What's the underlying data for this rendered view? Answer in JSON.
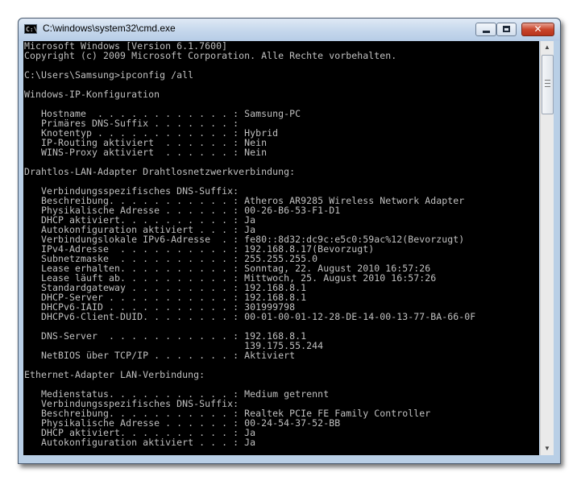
{
  "window": {
    "title": "C:\\windows\\system32\\cmd.exe",
    "icon": "cmd-icon",
    "controls": {
      "minimize": "minimize-icon",
      "maximize": "maximize-icon",
      "close_label": "✕"
    }
  },
  "colors": {
    "console_background": "#000000",
    "console_text": "#c0c0c0",
    "close_button": "#c9462c"
  },
  "console": {
    "lines": [
      "Microsoft Windows [Version 6.1.7600]",
      "Copyright (c) 2009 Microsoft Corporation. Alle Rechte vorbehalten.",
      "",
      "C:\\Users\\Samsung>ipconfig /all",
      "",
      "Windows-IP-Konfiguration",
      "",
      "   Hostname  . . . . . . . . . . . . : Samsung-PC",
      "   Primäres DNS-Suffix . . . . . . . :",
      "   Knotentyp . . . . . . . . . . . . : Hybrid",
      "   IP-Routing aktiviert  . . . . . . : Nein",
      "   WINS-Proxy aktiviert  . . . . . . : Nein",
      "",
      "Drahtlos-LAN-Adapter Drahtlosnetzwerkverbindung:",
      "",
      "   Verbindungsspezifisches DNS-Suffix:",
      "   Beschreibung. . . . . . . . . . . : Atheros AR9285 Wireless Network Adapter",
      "   Physikalische Adresse . . . . . . : 00-26-B6-53-F1-D1",
      "   DHCP aktiviert. . . . . . . . . . : Ja",
      "   Autokonfiguration aktiviert . . . : Ja",
      "   Verbindungslokale IPv6-Adresse  . : fe80::8d32:dc9c:e5c0:59ac%12(Bevorzugt)",
      "   IPv4-Adresse  . . . . . . . . . . : 192.168.8.17(Bevorzugt)",
      "   Subnetzmaske  . . . . . . . . . . : 255.255.255.0",
      "   Lease erhalten. . . . . . . . . . : Sonntag, 22. August 2010 16:57:26",
      "   Lease läuft ab. . . . . . . . . . : Mittwoch, 25. August 2010 16:57:26",
      "   Standardgateway . . . . . . . . . : 192.168.8.1",
      "   DHCP-Server . . . . . . . . . . . : 192.168.8.1",
      "   DHCPv6-IAID . . . . . . . . . . . : 301999798",
      "   DHCPv6-Client-DUID. . . . . . . . : 00-01-00-01-12-28-DE-14-00-13-77-BA-66-0F",
      "",
      "   DNS-Server  . . . . . . . . . . . : 192.168.8.1",
      "                                       139.175.55.244",
      "   NetBIOS über TCP/IP . . . . . . . : Aktiviert",
      "",
      "Ethernet-Adapter LAN-Verbindung:",
      "",
      "   Medienstatus. . . . . . . . . . . : Medium getrennt",
      "   Verbindungsspezifisches DNS-Suffix:",
      "   Beschreibung. . . . . . . . . . . : Realtek PCIe FE Family Controller",
      "   Physikalische Adresse . . . . . . : 00-24-54-37-52-BB",
      "   DHCP aktiviert. . . . . . . . . . : Ja",
      "   Autokonfiguration aktiviert . . . : Ja"
    ]
  },
  "scrollbar": {
    "up_arrow": "▲",
    "down_arrow": "▼",
    "position_fraction": 0.0,
    "visible_fraction": 0.15
  }
}
